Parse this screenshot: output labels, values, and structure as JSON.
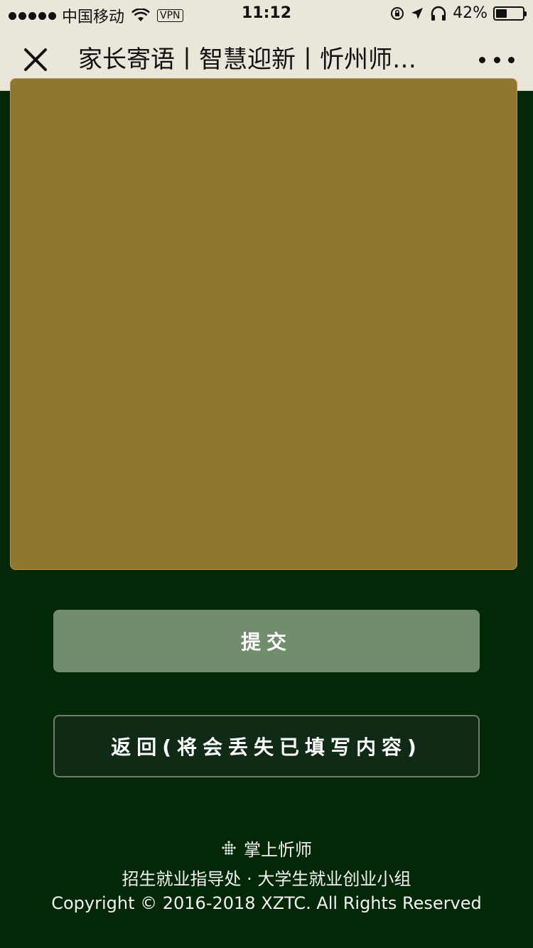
{
  "status_bar": {
    "carrier": "中国移动",
    "vpn": "VPN",
    "time": "11:12",
    "battery": "42%",
    "battery_level": 0.42
  },
  "nav": {
    "title": "家长寄语丨智慧迎新丨忻州师…"
  },
  "form": {
    "message_value": ""
  },
  "buttons": {
    "submit": "提交",
    "back": "返回(将会丢失已填写内容)"
  },
  "footer": {
    "brand": "掌上忻师",
    "org": "招生就业指导处 · 大学生就业创业小组",
    "copyright": "Copyright © 2016-2018 XZTC. All Rights Reserved"
  },
  "colors": {
    "background": "#032807",
    "textarea": "#91762e",
    "submit_button": "#728c6e",
    "back_button": "#0f2a15"
  }
}
